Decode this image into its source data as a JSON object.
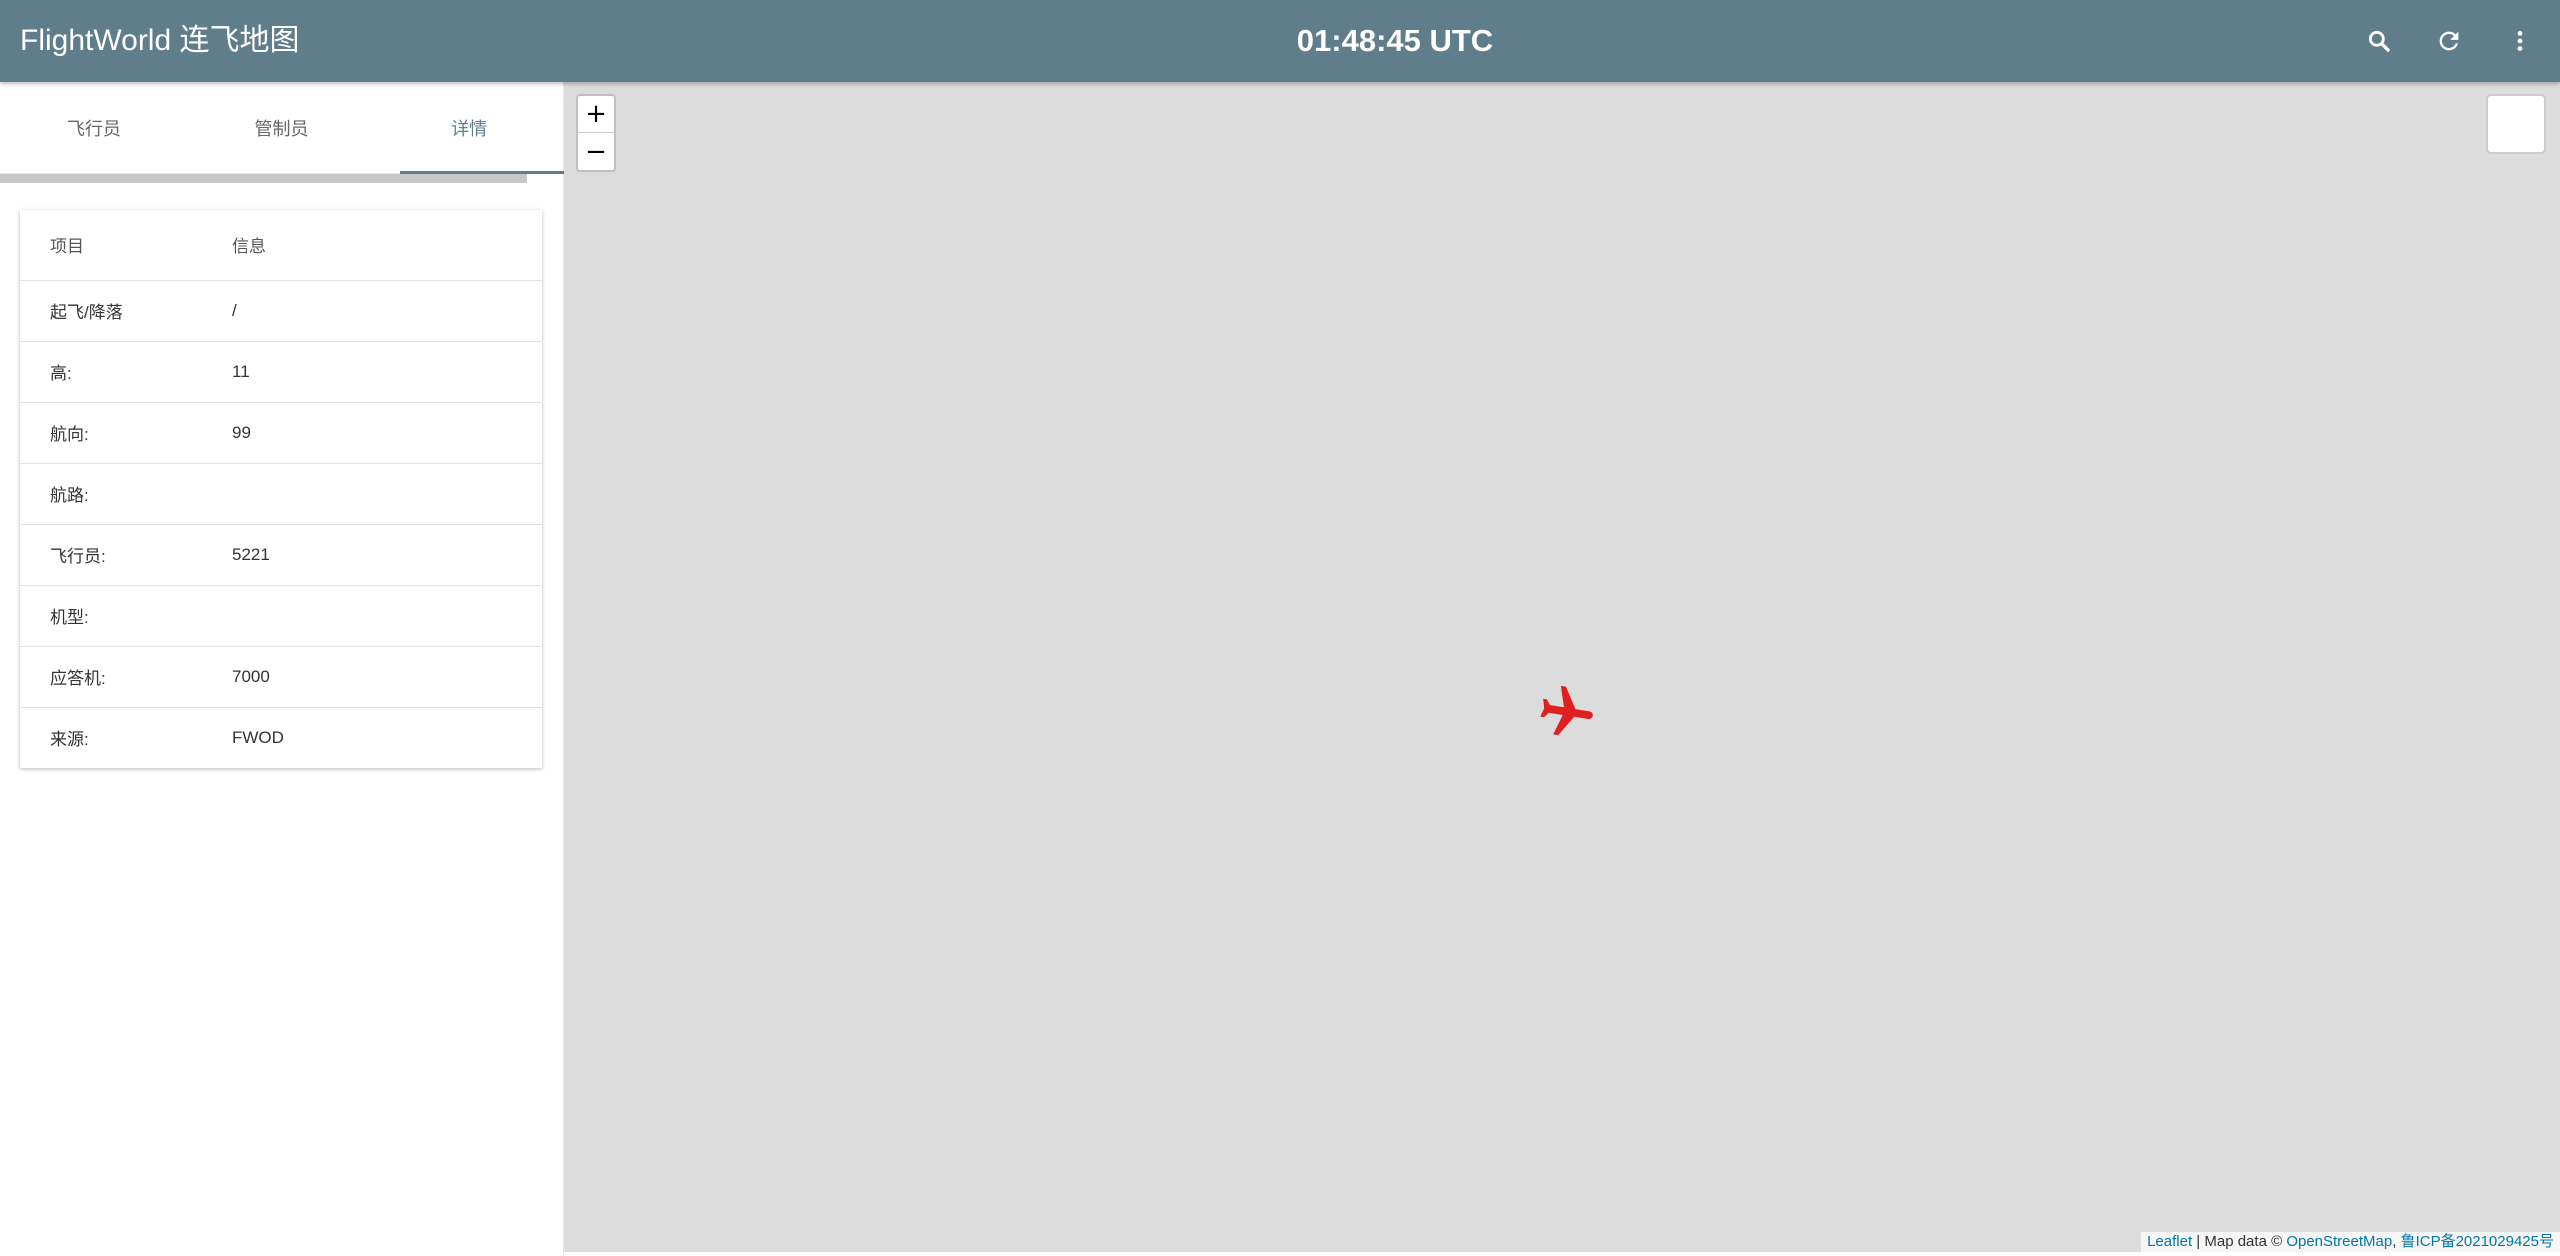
{
  "appbar": {
    "title": "FlightWorld 连飞地图",
    "clock": "01:48:45 UTC",
    "actions": [
      "search-icon",
      "refresh-icon",
      "more-vert-icon"
    ]
  },
  "colors": {
    "appbar": "#607d8b",
    "map_background": "#dddcdd",
    "aircraft": "#e0201f",
    "link": "#0078a8"
  },
  "sidebar": {
    "tabs": [
      {
        "label": "飞行员"
      },
      {
        "label": "管制员"
      },
      {
        "label": "详情",
        "active": true
      }
    ],
    "details": {
      "headers": [
        "项目",
        "信息"
      ],
      "rows": [
        {
          "label": "起飞/降落",
          "value": "/"
        },
        {
          "label": "高:",
          "value": "11"
        },
        {
          "label": "航向:",
          "value": "99"
        },
        {
          "label": "航路:",
          "value": ""
        },
        {
          "label": "飞行员:",
          "value": "5221"
        },
        {
          "label": "机型:",
          "value": ""
        },
        {
          "label": "应答机:",
          "value": "7000"
        },
        {
          "label": "来源:",
          "value": "FWOD"
        }
      ]
    }
  },
  "map": {
    "zoom_in": "+",
    "zoom_out": "−",
    "aircraft_icon": "airplane-icon",
    "attribution": {
      "leaflet": "Leaflet",
      "separator": " | Map data © ",
      "osm": "OpenStreetMap",
      "comma": ", ",
      "icp": "鲁ICP备2021029425号"
    }
  }
}
